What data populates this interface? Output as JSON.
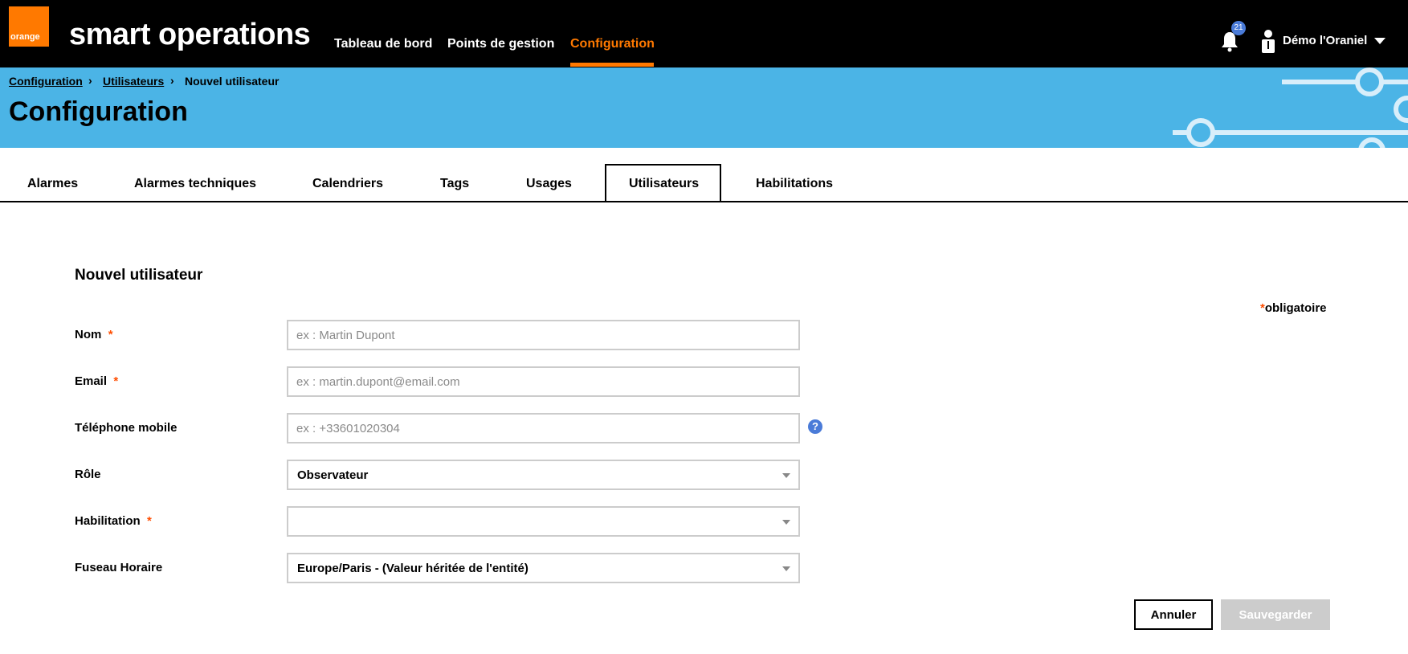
{
  "header": {
    "logo_text": "orange",
    "app_title": "smart operations",
    "nav": [
      {
        "label": "Tableau de bord"
      },
      {
        "label": "Points de gestion"
      },
      {
        "label": "Configuration"
      }
    ],
    "notification_count": "21",
    "user_name": "Démo l'Oraniel",
    "colors": {
      "brand": "#ff7900",
      "topbar": "#000000",
      "banner": "#4bb4e6",
      "badge": "#4a7bd8"
    }
  },
  "breadcrumb": [
    {
      "label": "Configuration"
    },
    {
      "label": "Utilisateurs"
    },
    {
      "label": "Nouvel utilisateur"
    }
  ],
  "breadcrumb_separator": "›",
  "page_title": "Configuration",
  "tabs": [
    {
      "label": "Alarmes"
    },
    {
      "label": "Alarmes techniques"
    },
    {
      "label": "Calendriers"
    },
    {
      "label": "Tags"
    },
    {
      "label": "Usages"
    },
    {
      "label": "Utilisateurs",
      "active": true
    },
    {
      "label": "Habilitations"
    }
  ],
  "form": {
    "title": "Nouvel utilisateur",
    "mandatory_note": "obligatoire",
    "required_mark": "*",
    "fields": {
      "nom": {
        "label": "Nom",
        "placeholder": "ex : Martin Dupont",
        "value": ""
      },
      "email": {
        "label": "Email",
        "placeholder": "ex : martin.dupont@email.com",
        "value": ""
      },
      "phone": {
        "label": "Téléphone mobile",
        "placeholder": "ex : +33601020304",
        "value": ""
      },
      "role": {
        "label": "Rôle",
        "value": "Observateur"
      },
      "habilitation": {
        "label": "Habilitation",
        "value": ""
      },
      "timezone": {
        "label": "Fuseau Horaire",
        "value": "Europe/Paris - (Valeur héritée de l'entité)"
      }
    },
    "help_glyph": "?",
    "cancel_label": "Annuler",
    "save_label": "Sauvegarder"
  }
}
